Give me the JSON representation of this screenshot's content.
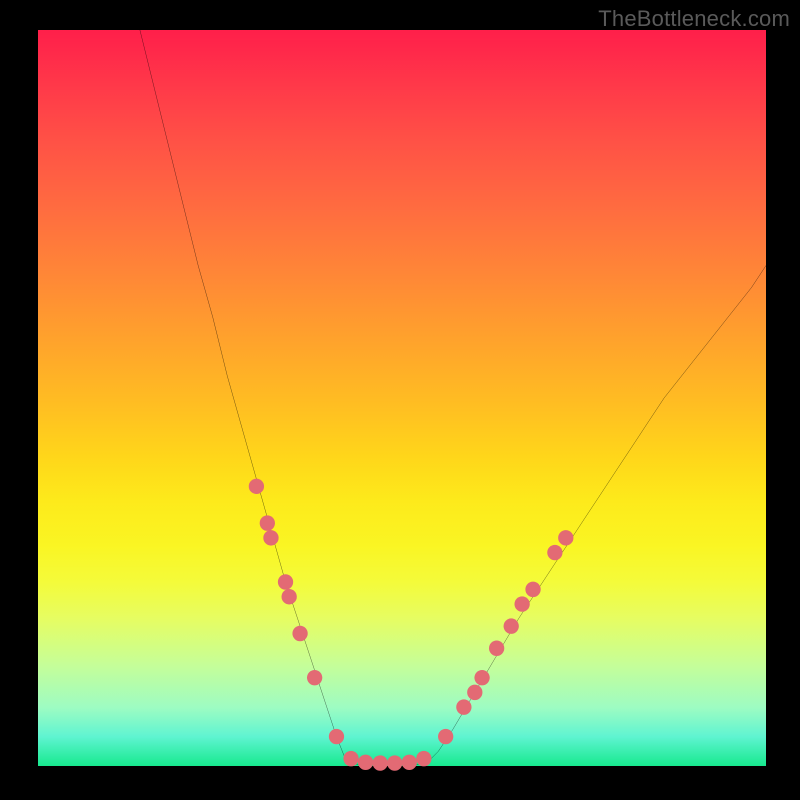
{
  "watermark": "TheBottleneck.com",
  "chart_data": {
    "type": "line",
    "title": "",
    "xlabel": "",
    "ylabel": "",
    "xlim": [
      0,
      100
    ],
    "ylim": [
      0,
      100
    ],
    "series": [
      {
        "name": "bottleneck-curve-left",
        "x": [
          14,
          16,
          18,
          20,
          22,
          24,
          26,
          28,
          30,
          32,
          34,
          36,
          38,
          40,
          41,
          42,
          42.5
        ],
        "y": [
          100,
          92,
          84,
          76,
          68,
          61,
          53,
          46,
          39,
          32,
          25,
          19,
          13,
          7,
          4,
          1.5,
          0.5
        ]
      },
      {
        "name": "bottleneck-curve-floor",
        "x": [
          42.5,
          44,
          46,
          48,
          50,
          52,
          53.5
        ],
        "y": [
          0.5,
          0.2,
          0.1,
          0.1,
          0.1,
          0.2,
          0.5
        ]
      },
      {
        "name": "bottleneck-curve-right",
        "x": [
          53.5,
          55,
          57,
          60,
          63,
          66,
          70,
          74,
          78,
          82,
          86,
          90,
          94,
          98,
          100
        ],
        "y": [
          0.5,
          2,
          5,
          10,
          15,
          20,
          26,
          32,
          38,
          44,
          50,
          55,
          60,
          65,
          68
        ]
      }
    ],
    "markers": {
      "name": "sample-points",
      "color": "#e36a74",
      "points": [
        {
          "x": 30.0,
          "y": 38
        },
        {
          "x": 31.5,
          "y": 33
        },
        {
          "x": 32.0,
          "y": 31
        },
        {
          "x": 34.0,
          "y": 25
        },
        {
          "x": 34.5,
          "y": 23
        },
        {
          "x": 36.0,
          "y": 18
        },
        {
          "x": 38.0,
          "y": 12
        },
        {
          "x": 41.0,
          "y": 4
        },
        {
          "x": 43.0,
          "y": 1
        },
        {
          "x": 45.0,
          "y": 0.5
        },
        {
          "x": 47.0,
          "y": 0.4
        },
        {
          "x": 49.0,
          "y": 0.4
        },
        {
          "x": 51.0,
          "y": 0.5
        },
        {
          "x": 53.0,
          "y": 1
        },
        {
          "x": 56.0,
          "y": 4
        },
        {
          "x": 58.5,
          "y": 8
        },
        {
          "x": 60.0,
          "y": 10
        },
        {
          "x": 61.0,
          "y": 12
        },
        {
          "x": 63.0,
          "y": 16
        },
        {
          "x": 65.0,
          "y": 19
        },
        {
          "x": 66.5,
          "y": 22
        },
        {
          "x": 68.0,
          "y": 24
        },
        {
          "x": 71.0,
          "y": 29
        },
        {
          "x": 72.5,
          "y": 31
        }
      ]
    },
    "gradient_stops": [
      {
        "pos": 0.0,
        "color": "#ff1f4a"
      },
      {
        "pos": 0.5,
        "color": "#ffd61a"
      },
      {
        "pos": 0.78,
        "color": "#f4fb3a"
      },
      {
        "pos": 1.0,
        "color": "#17e98e"
      }
    ]
  }
}
